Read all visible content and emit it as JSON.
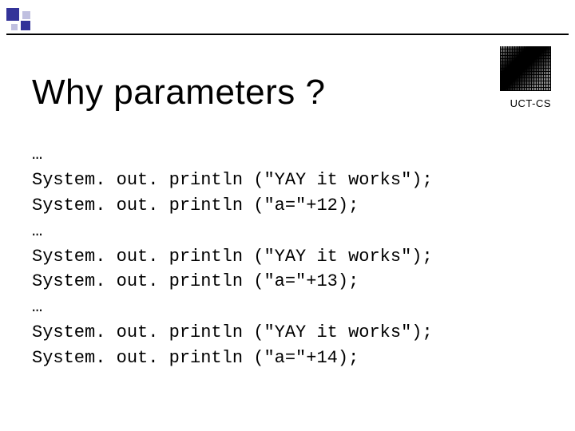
{
  "slide": {
    "title": "Why parameters ?",
    "affiliation": "UCT-CS",
    "code_lines": [
      "…",
      "System. out. println (\"YAY it works\");",
      "System. out. println (\"a=\"+12);",
      "…",
      "System. out. println (\"YAY it works\");",
      "System. out. println (\"a=\"+13);",
      "…",
      "System. out. println (\"YAY it works\");",
      "System. out. println (\"a=\"+14);"
    ]
  }
}
